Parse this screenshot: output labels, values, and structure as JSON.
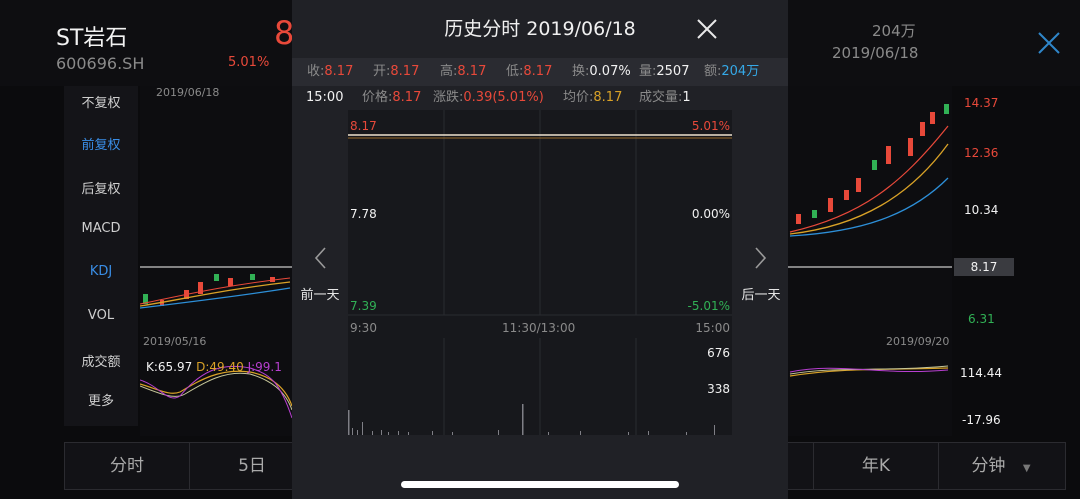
{
  "header": {
    "stock_name": "ST岩石",
    "stock_code": "600696.SH",
    "price_partial": "8",
    "change_pct": "5.01%",
    "amount": "204万",
    "date": "2019/06/18"
  },
  "side_menu": {
    "items": [
      {
        "label": "不复权"
      },
      {
        "label": "前复权"
      },
      {
        "label": "后复权"
      },
      {
        "label": "MACD"
      },
      {
        "label": "KDJ"
      },
      {
        "label": "VOL"
      },
      {
        "label": "成交额"
      },
      {
        "label": "更多"
      }
    ]
  },
  "main_chart": {
    "top_date": "2019/06/18",
    "start_date": "2019/05/16",
    "end_date": "2019/09/20",
    "price_ticks": [
      "14.37",
      "12.36",
      "10.34",
      "8.17",
      "6.31"
    ],
    "kdj_label_k": "K:65.97",
    "kdj_label_d": "D:49.40",
    "kdj_label_j": "J:99.1",
    "indicator_ticks": [
      "114.44",
      "-17.96"
    ],
    "colors": {
      "up": "#e8493a",
      "down": "#31b155"
    }
  },
  "bottom_tabs": {
    "items": [
      {
        "label": "分时"
      },
      {
        "label": "5日"
      },
      {
        "label": "年K"
      },
      {
        "label": "分钟"
      }
    ]
  },
  "modal": {
    "title": "历史分时 2019/06/18",
    "stats": {
      "close_label": "收:",
      "close_value": "8.17",
      "open_label": "开:",
      "open_value": "8.17",
      "high_label": "高:",
      "high_value": "8.17",
      "low_label": "低:",
      "low_value": "8.17",
      "turnover_label": "换:",
      "turnover_value": "0.07%",
      "volume_label": "量:",
      "volume_value": "2507",
      "amount_label": "额:",
      "amount_value": "204万"
    },
    "info": {
      "time": "15:00",
      "price_label": "价格:",
      "price_value": "8.17",
      "change_label": "涨跌:",
      "change_value": "0.39(5.01%)",
      "avg_label": "均价:",
      "avg_value": "8.17",
      "volume_label": "成交量:",
      "volume_value": "1"
    },
    "chart": {
      "top_price": "8.17",
      "top_pct": "5.01%",
      "mid_price": "7.78",
      "mid_pct": "0.00%",
      "bottom_price": "7.39",
      "bottom_pct": "-5.01%",
      "time_start": "9:30",
      "time_mid": "11:30/13:00",
      "time_end": "15:00",
      "vol_max": "676",
      "vol_mid": "338"
    },
    "prev_day_label": "前一天",
    "next_day_label": "后一天"
  }
}
